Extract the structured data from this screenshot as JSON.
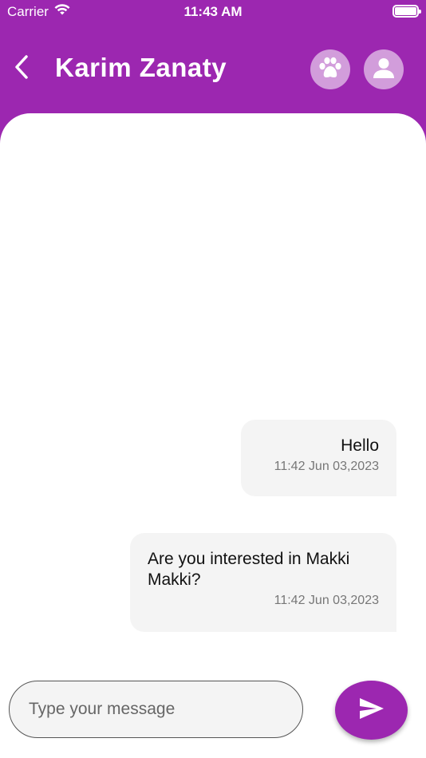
{
  "status_bar": {
    "carrier": "Carrier",
    "time": "11:43 AM",
    "wifi_icon": "wifi-icon",
    "battery_icon": "battery-icon"
  },
  "header": {
    "title": "Karim Zanaty",
    "back_icon": "chevron-left-icon",
    "paw_icon": "paw-icon",
    "profile_icon": "person-icon"
  },
  "messages": [
    {
      "text": "Hello",
      "timestamp": "11:42 Jun 03,2023"
    },
    {
      "text": "Are you interested in Makki Makki?",
      "timestamp": "11:42 Jun 03,2023"
    }
  ],
  "composer": {
    "placeholder": "Type your message",
    "send_icon": "send-icon"
  },
  "colors": {
    "primary": "#9c27b0",
    "bubble": "#f4f4f4",
    "panel": "#ffffff"
  }
}
